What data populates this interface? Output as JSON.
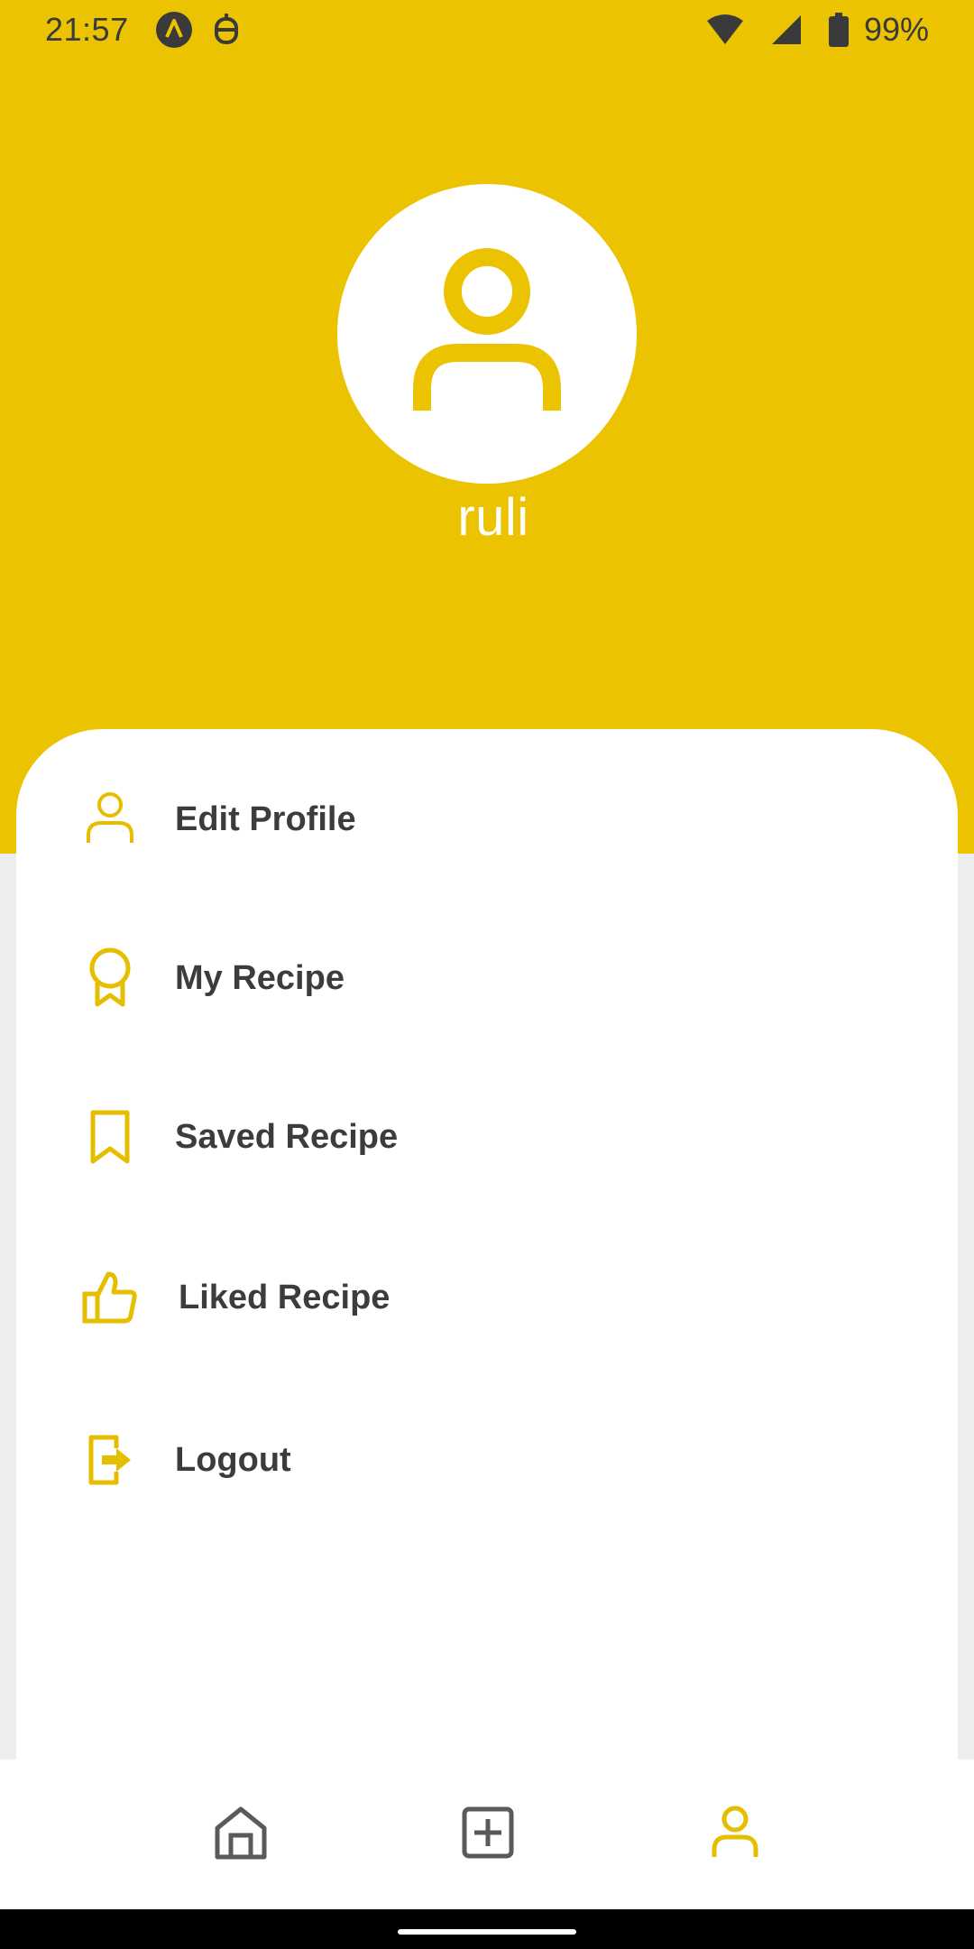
{
  "status_bar": {
    "time": "21:57",
    "battery": "99%",
    "icons": [
      "app-a-icon",
      "notification-icon",
      "wifi-icon",
      "cell-signal-icon",
      "battery-icon"
    ]
  },
  "profile": {
    "username": "ruli",
    "avatar_icon": "user-avatar-icon"
  },
  "menu": {
    "items": [
      {
        "label": "Edit Profile",
        "icon": "person-icon"
      },
      {
        "label": "My Recipe",
        "icon": "award-ribbon-icon"
      },
      {
        "label": "Saved Recipe",
        "icon": "bookmark-icon"
      },
      {
        "label": "Liked Recipe",
        "icon": "thumbs-up-icon"
      },
      {
        "label": "Logout",
        "icon": "logout-icon"
      }
    ]
  },
  "bottom_nav": {
    "items": [
      {
        "name": "home",
        "icon": "home-icon",
        "active": false
      },
      {
        "name": "add",
        "icon": "add-square-icon",
        "active": false
      },
      {
        "name": "profile",
        "icon": "profile-icon",
        "active": true
      }
    ]
  },
  "colors": {
    "accent": "#ECC300",
    "icon_yellow": "#E5BE00",
    "inactive_icon": "#5A5A5A",
    "text": "#3C3C3C",
    "background": "#EEEEEE"
  }
}
